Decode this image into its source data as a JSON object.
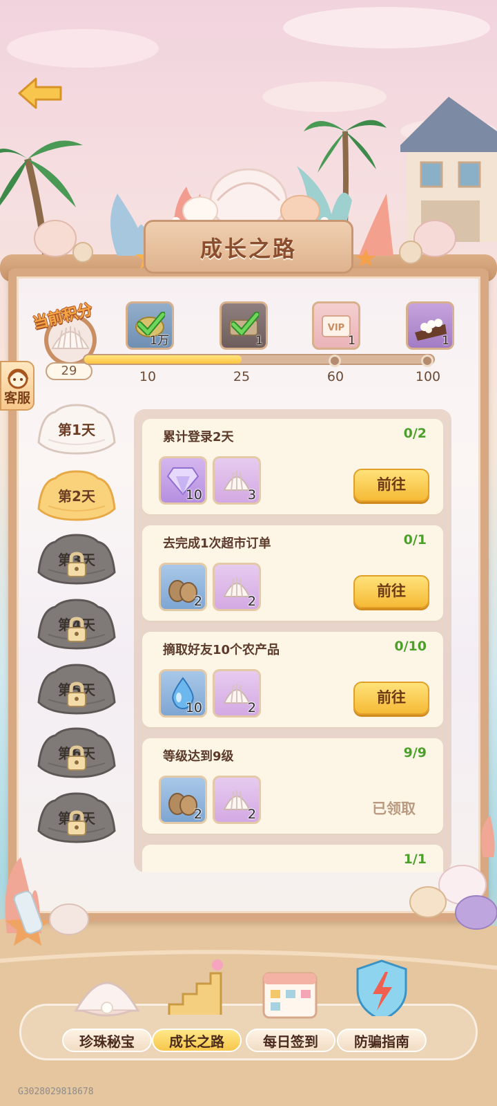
{
  "header": {
    "title": "成长之路"
  },
  "progress": {
    "score_label": "当前积分",
    "score": "29",
    "fill_ratio": 0.45,
    "ticks": [
      "10",
      "25",
      "60",
      "100"
    ],
    "rewards": [
      {
        "icon": "coin-icon",
        "qty": "1万",
        "claimed": true
      },
      {
        "icon": "ticket-icon",
        "qty": "1",
        "claimed": true
      },
      {
        "icon": "vip-card-icon",
        "qty": "1",
        "claimed": false
      },
      {
        "icon": "pearl-chest-icon",
        "qty": "1",
        "claimed": false
      }
    ]
  },
  "side": {
    "service_label": "客服"
  },
  "days": [
    {
      "label": "第1天",
      "state": "done"
    },
    {
      "label": "第2天",
      "state": "active"
    },
    {
      "label": "第3天",
      "state": "locked"
    },
    {
      "label": "第4天",
      "state": "locked"
    },
    {
      "label": "第5天",
      "state": "locked"
    },
    {
      "label": "第6天",
      "state": "locked"
    },
    {
      "label": "第7天",
      "state": "locked"
    }
  ],
  "tasks": [
    {
      "title": "累计登录2天",
      "progress": "0/2",
      "items": [
        {
          "icon": "diamond-icon",
          "qty": "10"
        },
        {
          "icon": "shell-icon",
          "qty": "3"
        }
      ],
      "action": "前往"
    },
    {
      "title": "去完成1次超市订单",
      "progress": "0/1",
      "items": [
        {
          "icon": "sacks-icon",
          "qty": "2"
        },
        {
          "icon": "shell-icon",
          "qty": "2"
        }
      ],
      "action": "前往"
    },
    {
      "title": "摘取好友10个农产品",
      "progress": "0/10",
      "items": [
        {
          "icon": "water-drop-icon",
          "qty": "10"
        },
        {
          "icon": "shell-icon",
          "qty": "2"
        }
      ],
      "action": "前往"
    },
    {
      "title": "等级达到9级",
      "progress": "9/9",
      "items": [
        {
          "icon": "sacks-icon",
          "qty": "2"
        },
        {
          "icon": "shell-icon",
          "qty": "2"
        }
      ],
      "status": "已领取"
    },
    {
      "title": "",
      "progress": "1/1"
    }
  ],
  "nav": [
    {
      "label": "珍珠秘宝",
      "icon": "pearl-oyster-icon"
    },
    {
      "label": "成长之路",
      "icon": "stairs-icon",
      "active": true
    },
    {
      "label": "每日签到",
      "icon": "calendar-icon"
    },
    {
      "label": "防骗指南",
      "icon": "shield-lightning-icon"
    }
  ],
  "footer": {
    "id": "G3028029818678"
  },
  "colors": {
    "accent": "#f5ba36",
    "progress_text": "#4b9f2a",
    "frame": "#d7a881"
  }
}
